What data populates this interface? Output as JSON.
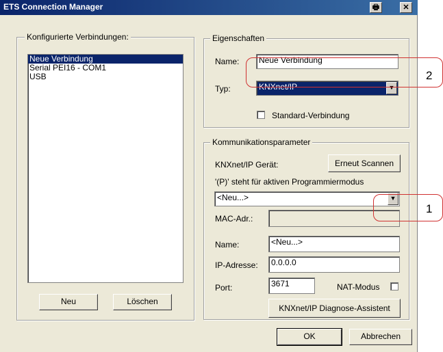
{
  "window": {
    "title": "ETS Connection Manager",
    "icon_buttons": {
      "help": "🖶",
      "close": "✕"
    }
  },
  "connections_group": {
    "legend": "Konfigurierte Verbindungen:",
    "items": [
      "Neue Verbindung",
      "Serial PEI16 - COM1",
      "USB"
    ],
    "selected_index": 0,
    "new_button": "Neu",
    "delete_button": "Löschen"
  },
  "properties_group": {
    "legend": "Eigenschaften",
    "name_label": "Name:",
    "name_value": "Neue Verbindung",
    "type_label": "Typ:",
    "type_value": "KNXnet/IP",
    "standard_label": "Standard-Verbindung",
    "standard_checked": false
  },
  "comm_group": {
    "legend": "Kommunikationsparameter",
    "device_label": "KNXnet/IP Gerät:",
    "rescan_button": "Erneut Scannen",
    "hint": "'(P)' steht für aktiven Programmiermodus",
    "device_value": "<Neu...>",
    "mac_label": "MAC-Adr.:",
    "mac_value": "",
    "name_label": "Name:",
    "name_value": "<Neu...>",
    "ip_label": "IP-Adresse:",
    "ip_value": "0.0.0.0",
    "port_label": "Port:",
    "port_value": "3671",
    "nat_label": "NAT-Modus",
    "nat_checked": false,
    "diag_button": "KNXnet/IP Diagnose-Assistent"
  },
  "footer": {
    "ok_button": "OK",
    "cancel_button": "Abbrechen"
  },
  "annotations": {
    "callout_1": "1",
    "callout_2": "2",
    "color": "#d03030"
  }
}
